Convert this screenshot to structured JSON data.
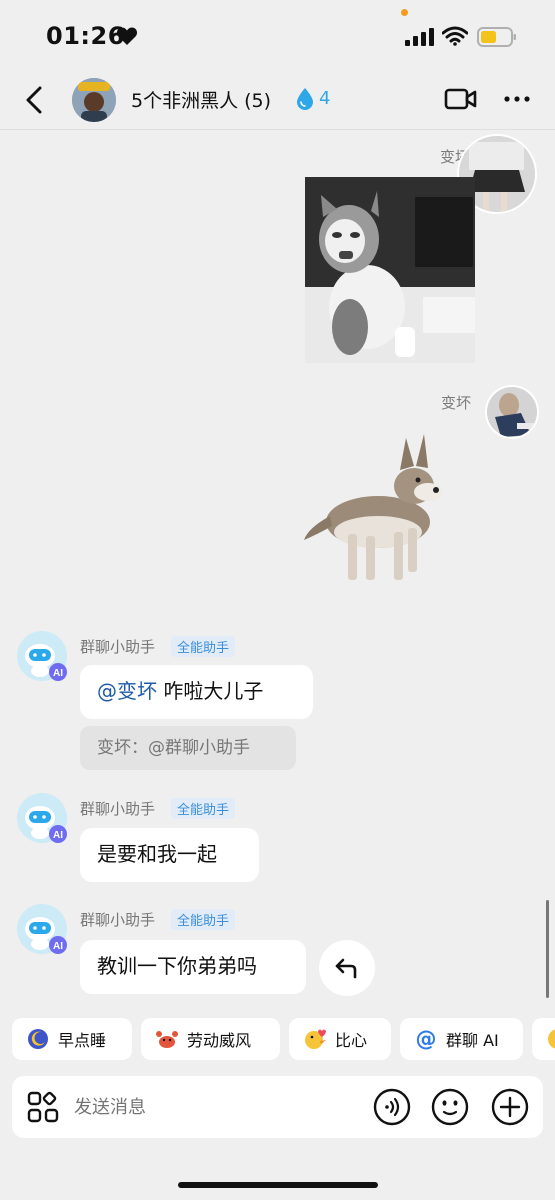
{
  "status_bar": {
    "time": "01:26",
    "battery_color": "#f3c21b"
  },
  "header": {
    "title": "5个非洲黑人 (5)",
    "drop_count": "4",
    "drop_color": "#2ea6e8"
  },
  "messages": {
    "m1": {
      "sender": "变坏",
      "type": "image",
      "subject": "cat-meme"
    },
    "m2": {
      "sender": "变坏",
      "type": "image",
      "subject": "husky-puppy"
    },
    "m3": {
      "sender": "群聊小助手",
      "badge": "全能助手",
      "mention": "@变坏",
      "text": " 咋啦大儿子",
      "quote": "变坏：@群聊小助手"
    },
    "m4": {
      "sender": "群聊小助手",
      "badge": "全能助手",
      "text": "是要和我一起"
    },
    "m5": {
      "sender": "群聊小助手",
      "badge": "全能助手",
      "text": "教训一下你弟弟吗"
    }
  },
  "chips": [
    {
      "label": "早点睡",
      "icon": "moon-icon"
    },
    {
      "label": "劳动威风",
      "icon": "crab-icon"
    },
    {
      "label": "比心",
      "icon": "duck-heart-icon"
    },
    {
      "label": "群聊 AI",
      "icon": "at-icon"
    }
  ],
  "input": {
    "placeholder": "发送消息"
  },
  "colors": {
    "background": "#efefef",
    "bubble": "#ffffff",
    "accent": "#1e5aa8",
    "badge_bg": "#e2ecf9"
  }
}
